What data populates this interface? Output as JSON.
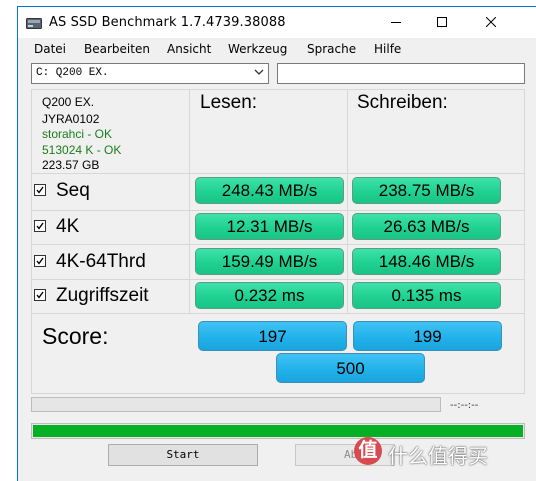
{
  "window": {
    "title": "AS SSD Benchmark 1.7.4739.38088"
  },
  "menu": [
    "Datei",
    "Bearbeiten",
    "Ansicht",
    "Werkzeug",
    "Sprache",
    "Hilfe"
  ],
  "drive": {
    "selected": "C: Q200 EX.",
    "text_field_value": ""
  },
  "info": {
    "model": "Q200 EX.",
    "firmware": "JYRA0102",
    "driver": "storahci - OK",
    "alignment": "513024 K - OK",
    "capacity": "223.57 GB"
  },
  "columns": {
    "read": "Lesen:",
    "write": "Schreiben:"
  },
  "tests": [
    {
      "label": "Seq",
      "checked": true,
      "read": "248.43 MB/s",
      "write": "238.75 MB/s"
    },
    {
      "label": "4K",
      "checked": true,
      "read": "12.31 MB/s",
      "write": "26.63 MB/s"
    },
    {
      "label": "4K-64Thrd",
      "checked": true,
      "read": "159.49 MB/s",
      "write": "148.46 MB/s"
    },
    {
      "label": "Zugriffszeit",
      "checked": true,
      "read": "0.232 ms",
      "write": "0.135 ms"
    }
  ],
  "score": {
    "label": "Score:",
    "read": "197",
    "write": "199",
    "total": "500"
  },
  "progress": {
    "time": "--:--:--",
    "current_fraction": 0,
    "total_fraction": 1
  },
  "buttons": {
    "start": "Start",
    "abort": "Abbr"
  },
  "watermark": {
    "badge": "值",
    "text": "什么值得买"
  },
  "colors": {
    "result_green": "#20d193",
    "score_blue": "#22b2eb",
    "progress_green": "#06b025",
    "status_ok_green": "#1a7d1a",
    "title_accent": "#0078d7"
  }
}
